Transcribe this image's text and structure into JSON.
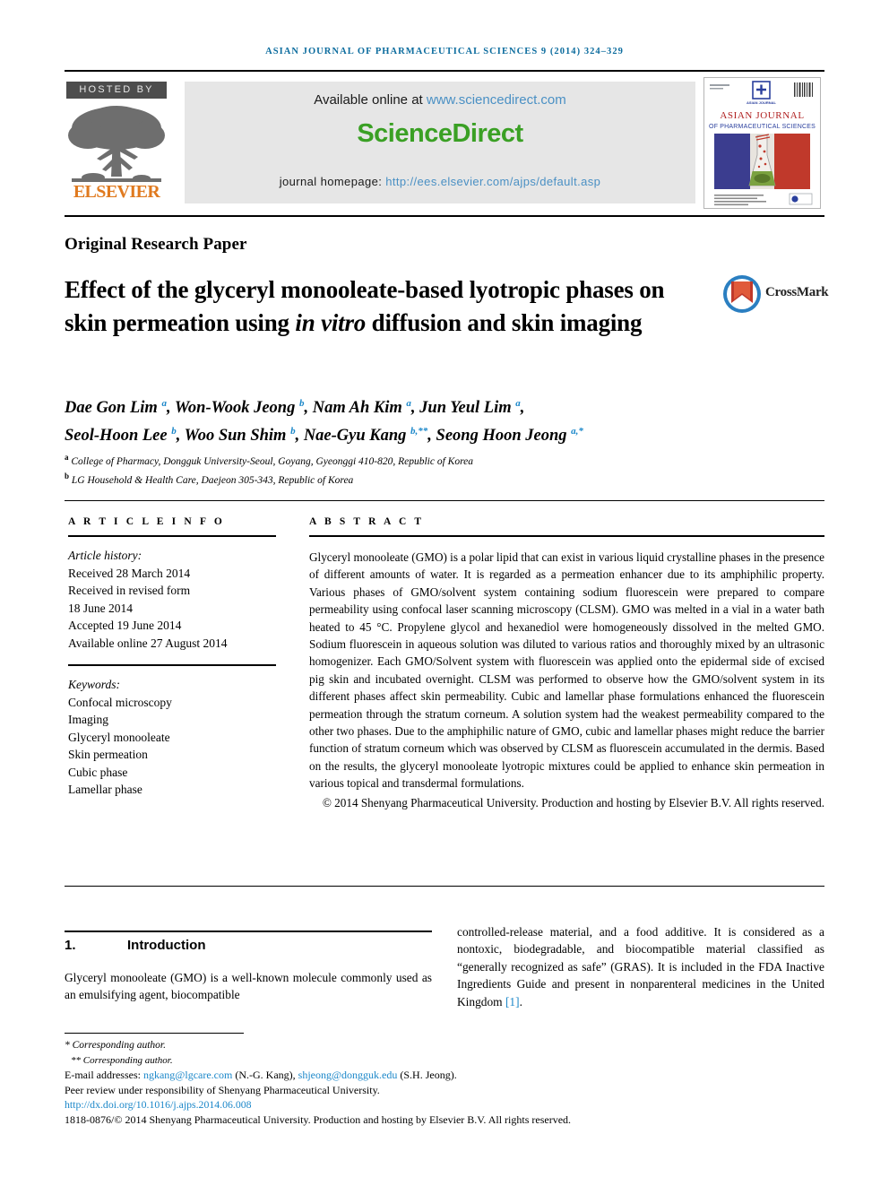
{
  "running_head": "ASIAN JOURNAL OF PHARMACEUTICAL SCIENCES 9 (2014) 324–329",
  "masthead": {
    "hosted_by": "HOSTED BY",
    "publisher": "ELSEVIER",
    "available_prefix": "Available online at ",
    "available_link": "www.sciencedirect.com",
    "sciencedirect_logo": "ScienceDirect",
    "homepage_prefix": "journal homepage: ",
    "homepage_link": "http://ees.elsevier.com/ajps/default.asp",
    "cover": {
      "journal_mark": "ASIAN JOURNAL",
      "title_line1": "ASIAN JOURNAL",
      "title_line2": "OF PHARMACEUTICAL SCIENCES"
    }
  },
  "article": {
    "type": "Original Research Paper",
    "title_part1": "Effect of the glyceryl monooleate-based lyotropic phases on skin permeation using ",
    "title_italic": "in vitro",
    "title_part2": " diffusion and skin imaging",
    "crossmark_label": "CrossMark"
  },
  "authors": {
    "list": [
      {
        "name": "Dae Gon Lim",
        "sup": "a"
      },
      {
        "name": "Won-Wook Jeong",
        "sup": "b"
      },
      {
        "name": "Nam Ah Kim",
        "sup": "a"
      },
      {
        "name": "Jun Yeul Lim",
        "sup": "a"
      },
      {
        "name": "Seol-Hoon Lee",
        "sup": "b"
      },
      {
        "name": "Woo Sun Shim",
        "sup": "b"
      },
      {
        "name": "Nae-Gyu Kang",
        "sup": "b,**"
      },
      {
        "name": "Seong Hoon Jeong",
        "sup": "a,*"
      }
    ],
    "affiliations": [
      {
        "marker": "a",
        "text": "College of Pharmacy, Dongguk University-Seoul, Goyang, Gyeonggi 410-820, Republic of Korea"
      },
      {
        "marker": "b",
        "text": "LG Household & Health Care, Daejeon 305-343, Republic of Korea"
      }
    ]
  },
  "article_info": {
    "heading": "A R T I C L E  I N F O",
    "history_label": "Article history:",
    "history": [
      "Received 28 March 2014",
      "Received in revised form",
      "18 June 2014",
      "Accepted 19 June 2014",
      "Available online 27 August 2014"
    ],
    "keywords_label": "Keywords:",
    "keywords": [
      "Confocal microscopy",
      "Imaging",
      "Glyceryl monooleate",
      "Skin permeation",
      "Cubic phase",
      "Lamellar phase"
    ]
  },
  "abstract": {
    "heading": "A B S T R A C T",
    "text": "Glyceryl monooleate (GMO) is a polar lipid that can exist in various liquid crystalline phases in the presence of different amounts of water. It is regarded as a permeation enhancer due to its amphiphilic property. Various phases of GMO/solvent system containing sodium fluorescein were prepared to compare permeability using confocal laser scanning microscopy (CLSM). GMO was melted in a vial in a water bath heated to 45 °C. Propylene glycol and hexanediol were homogeneously dissolved in the melted GMO. Sodium fluorescein in aqueous solution was diluted to various ratios and thoroughly mixed by an ultrasonic homogenizer. Each GMO/Solvent system with fluorescein was applied onto the epidermal side of excised pig skin and incubated overnight. CLSM was performed to observe how the GMO/solvent system in its different phases affect skin permeability. Cubic and lamellar phase formulations enhanced the fluorescein permeation through the stratum corneum. A solution system had the weakest permeability compared to the other two phases. Due to the amphiphilic nature of GMO, cubic and lamellar phases might reduce the barrier function of stratum corneum which was observed by CLSM as fluorescein accumulated in the dermis. Based on the results, the glyceryl monooleate lyotropic mixtures could be applied to enhance skin permeation in various topical and transdermal formulations.",
    "copyright": "© 2014 Shenyang Pharmaceutical University. Production and hosting by Elsevier B.V. All rights reserved."
  },
  "introduction": {
    "number": "1.",
    "title": "Introduction",
    "left_text": "Glyceryl monooleate (GMO) is a well-known molecule commonly used as an emulsifying agent, biocompatible",
    "right_text_part1": "controlled-release material, and a food additive. It is considered as a nontoxic, biodegradable, and biocompatible material classified as “generally recognized as safe” (GRAS). It is included in the FDA Inactive Ingredients Guide and present in nonparenteral medicines in the United Kingdom ",
    "right_ref": "[1]",
    "right_text_part2": "."
  },
  "footnotes": {
    "corresponding_1": "* Corresponding author.",
    "corresponding_2": "** Corresponding author.",
    "email_label": "E-mail addresses: ",
    "email_1": "ngkang@lgcare.com",
    "email_1_name": " (N.-G. Kang), ",
    "email_2": "shjeong@dongguk.edu",
    "email_2_name": " (S.H. Jeong).",
    "peer_review": "Peer review under responsibility of Shenyang Pharmaceutical University.",
    "doi": "http://dx.doi.org/10.1016/j.ajps.2014.06.008",
    "issn": "1818-0876/© 2014 Shenyang Pharmaceutical University. Production and hosting by Elsevier B.V. All rights reserved."
  },
  "colors": {
    "running_head": "#0c6c9e",
    "sciencedirect_green": "#3aa024",
    "link_blue": "#4a90c4",
    "elsevier_orange": "#e07a1f",
    "ref_blue": "#1b87c9"
  }
}
